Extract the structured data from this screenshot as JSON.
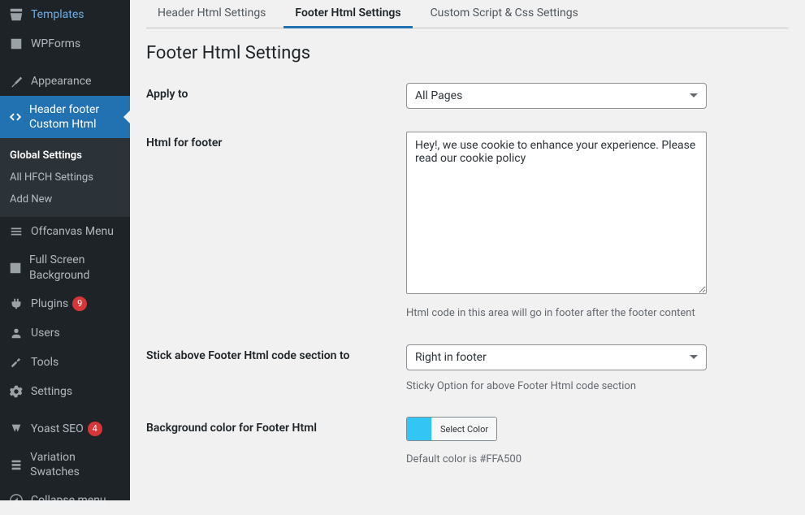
{
  "sidebar": {
    "items": [
      {
        "label": "Templates"
      },
      {
        "label": "WPForms"
      },
      {
        "label": "Appearance"
      },
      {
        "label": "Header footer Custom Html",
        "current": true
      },
      {
        "label": "Offcanvas Menu"
      },
      {
        "label": "Full Screen Background"
      },
      {
        "label": "Plugins",
        "badge": "9"
      },
      {
        "label": "Users"
      },
      {
        "label": "Tools"
      },
      {
        "label": "Settings"
      },
      {
        "label": "Yoast SEO",
        "badge": "4"
      },
      {
        "label": "Variation Swatches"
      }
    ],
    "submenu": {
      "items": [
        {
          "label": "Global Settings",
          "current": true
        },
        {
          "label": "All HFCH Settings"
        },
        {
          "label": "Add New"
        }
      ]
    },
    "collapse": "Collapse menu"
  },
  "tabs": [
    {
      "label": "Header Html Settings",
      "active": false
    },
    {
      "label": "Footer Html Settings",
      "active": true
    },
    {
      "label": "Custom Script & Css Settings",
      "active": false
    }
  ],
  "page_title": "Footer Html Settings",
  "form": {
    "apply_to": {
      "label": "Apply to",
      "value": "All Pages"
    },
    "html_footer": {
      "label": "Html for footer",
      "value": "Hey!, we use cookie to enhance your experience. Please read our cookie policy",
      "help": "Html code in this area will go in footer after the footer content"
    },
    "stick": {
      "label": "Stick above Footer Html code section to",
      "value": "Right in footer",
      "help": "Sticky Option for above Footer Html code section"
    },
    "bgcolor": {
      "label": "Background color for Footer Html",
      "button": "Select Color",
      "swatch": "#33c6f4",
      "help": "Default color is #FFA500"
    }
  }
}
